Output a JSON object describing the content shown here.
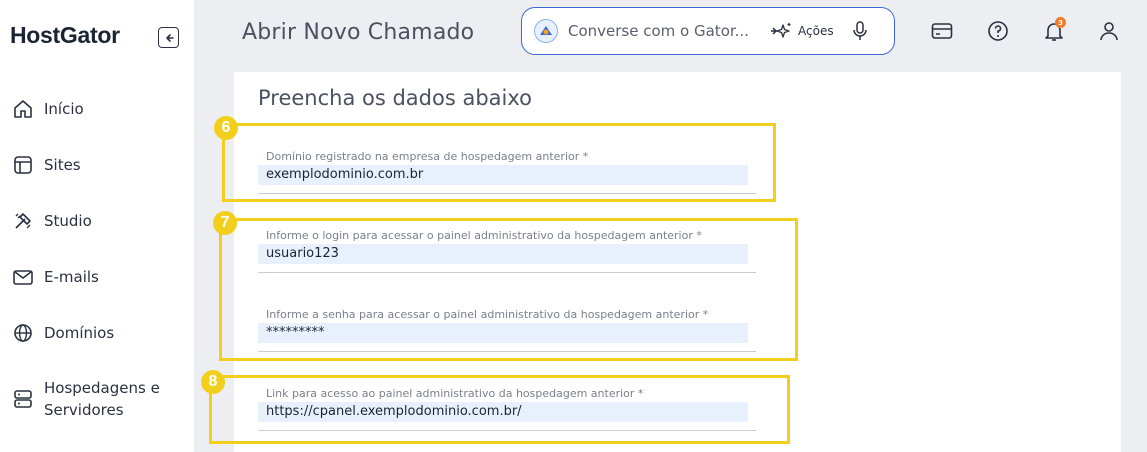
{
  "sidebar": {
    "logo": "HostGator",
    "items": [
      {
        "label": "Início",
        "icon": "home-icon"
      },
      {
        "label": "Sites",
        "icon": "layout-icon"
      },
      {
        "label": "Studio",
        "icon": "studio-icon"
      },
      {
        "label": "E-mails",
        "icon": "mail-icon"
      },
      {
        "label": "Domínios",
        "icon": "globe-icon"
      },
      {
        "label_line1": "Hospedagens e",
        "label_line2": "Servidores",
        "icon": "server-icon"
      }
    ]
  },
  "header": {
    "title": "Abrir Novo Chamado",
    "chat_placeholder": "Converse com o Gator...",
    "actions_label": "Ações",
    "notification_count": "3"
  },
  "form": {
    "title": "Preencha os dados abaixo",
    "fields": [
      {
        "label": "Domínio registrado na empresa de hospedagem anterior *",
        "value": "exemplodominio.com.br"
      },
      {
        "label": "Informe o login para acessar o painel administrativo da hospedagem anterior *",
        "value": "usuario123"
      },
      {
        "label": "Informe a senha para acessar o painel administrativo da hospedagem anterior *",
        "value": "*********"
      },
      {
        "label": "Link para acesso ao painel administrativo da hospedagem anterior *",
        "value": "https://cpanel.exemplodominio.com.br/"
      }
    ]
  },
  "annotations": [
    "6",
    "7",
    "8"
  ],
  "colors": {
    "highlight": "#f2cf1d",
    "accent": "#3c66d6",
    "badge": "#f07b28"
  }
}
